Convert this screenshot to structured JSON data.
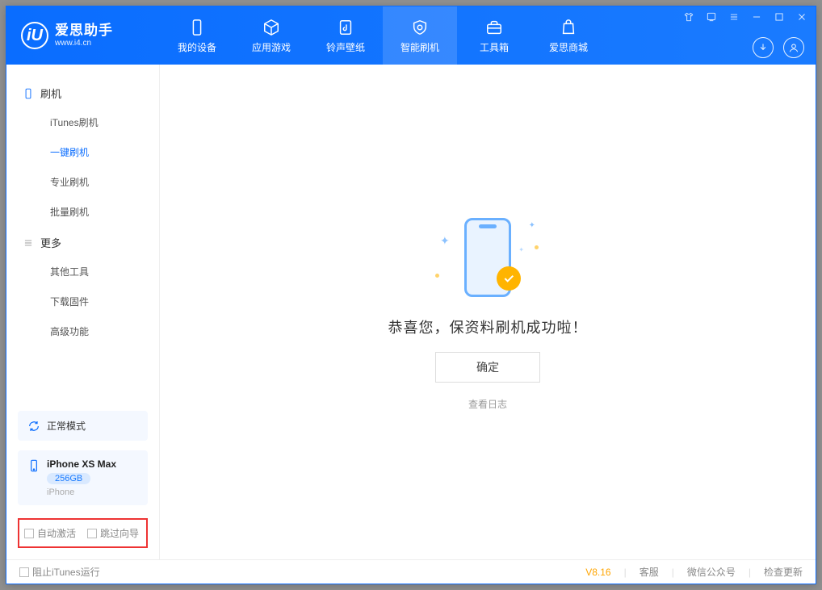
{
  "brand": {
    "title": "爱思助手",
    "subtitle": "www.i4.cn",
    "logo_letter": "iU"
  },
  "tabs": [
    {
      "label": "我的设备",
      "icon": "device-icon"
    },
    {
      "label": "应用游戏",
      "icon": "cube-icon"
    },
    {
      "label": "铃声壁纸",
      "icon": "music-file-icon"
    },
    {
      "label": "智能刷机",
      "icon": "refresh-shield-icon",
      "active": true
    },
    {
      "label": "工具箱",
      "icon": "toolbox-icon"
    },
    {
      "label": "爱思商城",
      "icon": "bag-icon"
    }
  ],
  "sidebar": {
    "group1": {
      "title": "刷机",
      "items": [
        "iTunes刷机",
        "一键刷机",
        "专业刷机",
        "批量刷机"
      ],
      "active_index": 1
    },
    "group2": {
      "title": "更多",
      "items": [
        "其他工具",
        "下载固件",
        "高级功能"
      ]
    },
    "mode": "正常模式",
    "device": {
      "name": "iPhone XS Max",
      "capacity": "256GB",
      "type": "iPhone"
    },
    "options": {
      "auto_activate": "自动激活",
      "skip_guide": "跳过向导"
    }
  },
  "main": {
    "success_title": "恭喜您，保资料刷机成功啦！",
    "ok_button": "确定",
    "view_log": "查看日志"
  },
  "footer": {
    "block_itunes": "阻止iTunes运行",
    "version": "V8.16",
    "links": [
      "客服",
      "微信公众号",
      "检查更新"
    ]
  }
}
